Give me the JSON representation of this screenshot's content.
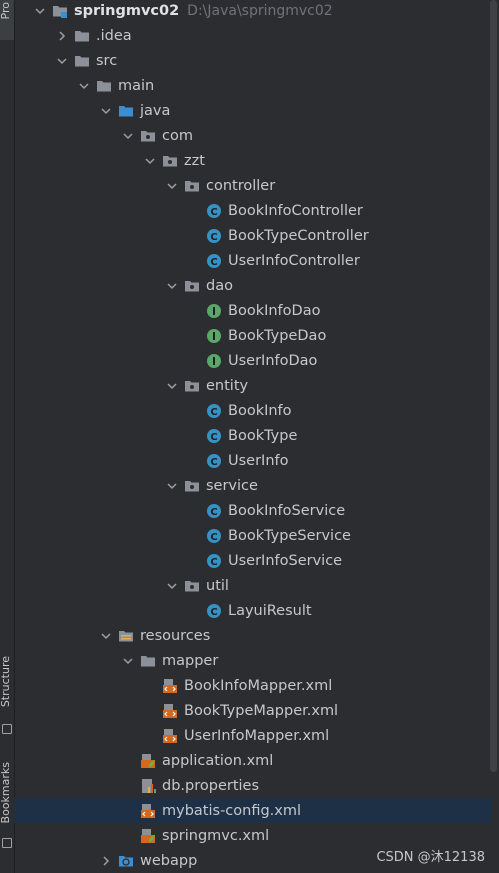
{
  "side_strip": {
    "project_tab": "Pro",
    "structure_tab": "Structure",
    "bookmarks_tab": "Bookmarks"
  },
  "tree": [
    {
      "label": "springmvc02",
      "path": "D:\\Java\\springmvc02",
      "depth": 0,
      "chevron": "down",
      "icon": "module-folder-icon",
      "root": true
    },
    {
      "label": ".idea",
      "depth": 1,
      "chevron": "right",
      "icon": "folder-icon"
    },
    {
      "label": "src",
      "depth": 1,
      "chevron": "down",
      "icon": "folder-icon"
    },
    {
      "label": "main",
      "depth": 2,
      "chevron": "down",
      "icon": "folder-icon"
    },
    {
      "label": "java",
      "depth": 3,
      "chevron": "down",
      "icon": "source-folder-icon"
    },
    {
      "label": "com",
      "depth": 4,
      "chevron": "down",
      "icon": "package-icon"
    },
    {
      "label": "zzt",
      "depth": 5,
      "chevron": "down",
      "icon": "package-icon"
    },
    {
      "label": "controller",
      "depth": 6,
      "chevron": "down",
      "icon": "package-icon"
    },
    {
      "label": "BookInfoController",
      "depth": 7,
      "chevron": "none",
      "icon": "class-icon"
    },
    {
      "label": "BookTypeController",
      "depth": 7,
      "chevron": "none",
      "icon": "class-icon"
    },
    {
      "label": "UserInfoController",
      "depth": 7,
      "chevron": "none",
      "icon": "class-icon"
    },
    {
      "label": "dao",
      "depth": 6,
      "chevron": "down",
      "icon": "package-icon"
    },
    {
      "label": "BookInfoDao",
      "depth": 7,
      "chevron": "none",
      "icon": "interface-icon"
    },
    {
      "label": "BookTypeDao",
      "depth": 7,
      "chevron": "none",
      "icon": "interface-icon"
    },
    {
      "label": "UserInfoDao",
      "depth": 7,
      "chevron": "none",
      "icon": "interface-icon"
    },
    {
      "label": "entity",
      "depth": 6,
      "chevron": "down",
      "icon": "package-icon"
    },
    {
      "label": "BookInfo",
      "depth": 7,
      "chevron": "none",
      "icon": "class-icon"
    },
    {
      "label": "BookType",
      "depth": 7,
      "chevron": "none",
      "icon": "class-icon"
    },
    {
      "label": "UserInfo",
      "depth": 7,
      "chevron": "none",
      "icon": "class-icon"
    },
    {
      "label": "service",
      "depth": 6,
      "chevron": "down",
      "icon": "package-icon"
    },
    {
      "label": "BookInfoService",
      "depth": 7,
      "chevron": "none",
      "icon": "class-icon"
    },
    {
      "label": "BookTypeService",
      "depth": 7,
      "chevron": "none",
      "icon": "class-icon"
    },
    {
      "label": "UserInfoService",
      "depth": 7,
      "chevron": "none",
      "icon": "class-icon"
    },
    {
      "label": "util",
      "depth": 6,
      "chevron": "down",
      "icon": "package-icon"
    },
    {
      "label": "LayuiResult",
      "depth": 7,
      "chevron": "none",
      "icon": "class-icon"
    },
    {
      "label": "resources",
      "depth": 3,
      "chevron": "down",
      "icon": "resources-folder-icon"
    },
    {
      "label": "mapper",
      "depth": 4,
      "chevron": "down",
      "icon": "folder-icon"
    },
    {
      "label": "BookInfoMapper.xml",
      "depth": 5,
      "chevron": "none",
      "icon": "mybatis-xml-icon"
    },
    {
      "label": "BookTypeMapper.xml",
      "depth": 5,
      "chevron": "none",
      "icon": "mybatis-xml-icon"
    },
    {
      "label": "UserInfoMapper.xml",
      "depth": 5,
      "chevron": "none",
      "icon": "mybatis-xml-icon"
    },
    {
      "label": "application.xml",
      "depth": 4,
      "chevron": "none",
      "icon": "spring-xml-icon"
    },
    {
      "label": "db.properties",
      "depth": 4,
      "chevron": "none",
      "icon": "properties-icon"
    },
    {
      "label": "mybatis-config.xml",
      "depth": 4,
      "chevron": "none",
      "icon": "mybatis-xml-icon",
      "selected": true
    },
    {
      "label": "springmvc.xml",
      "depth": 4,
      "chevron": "none",
      "icon": "spring-xml-icon"
    },
    {
      "label": "webapp",
      "depth": 3,
      "chevron": "right",
      "icon": "web-folder-icon"
    }
  ],
  "watermark": "CSDN @沐12138",
  "colors": {
    "background": "#2b2d30",
    "selection": "#1e3046",
    "class_icon": "#3592c4",
    "interface_icon": "#59a869",
    "folder": "#8c9199",
    "source_folder": "#3d8ed1",
    "xml_icon": "#d2691e"
  }
}
